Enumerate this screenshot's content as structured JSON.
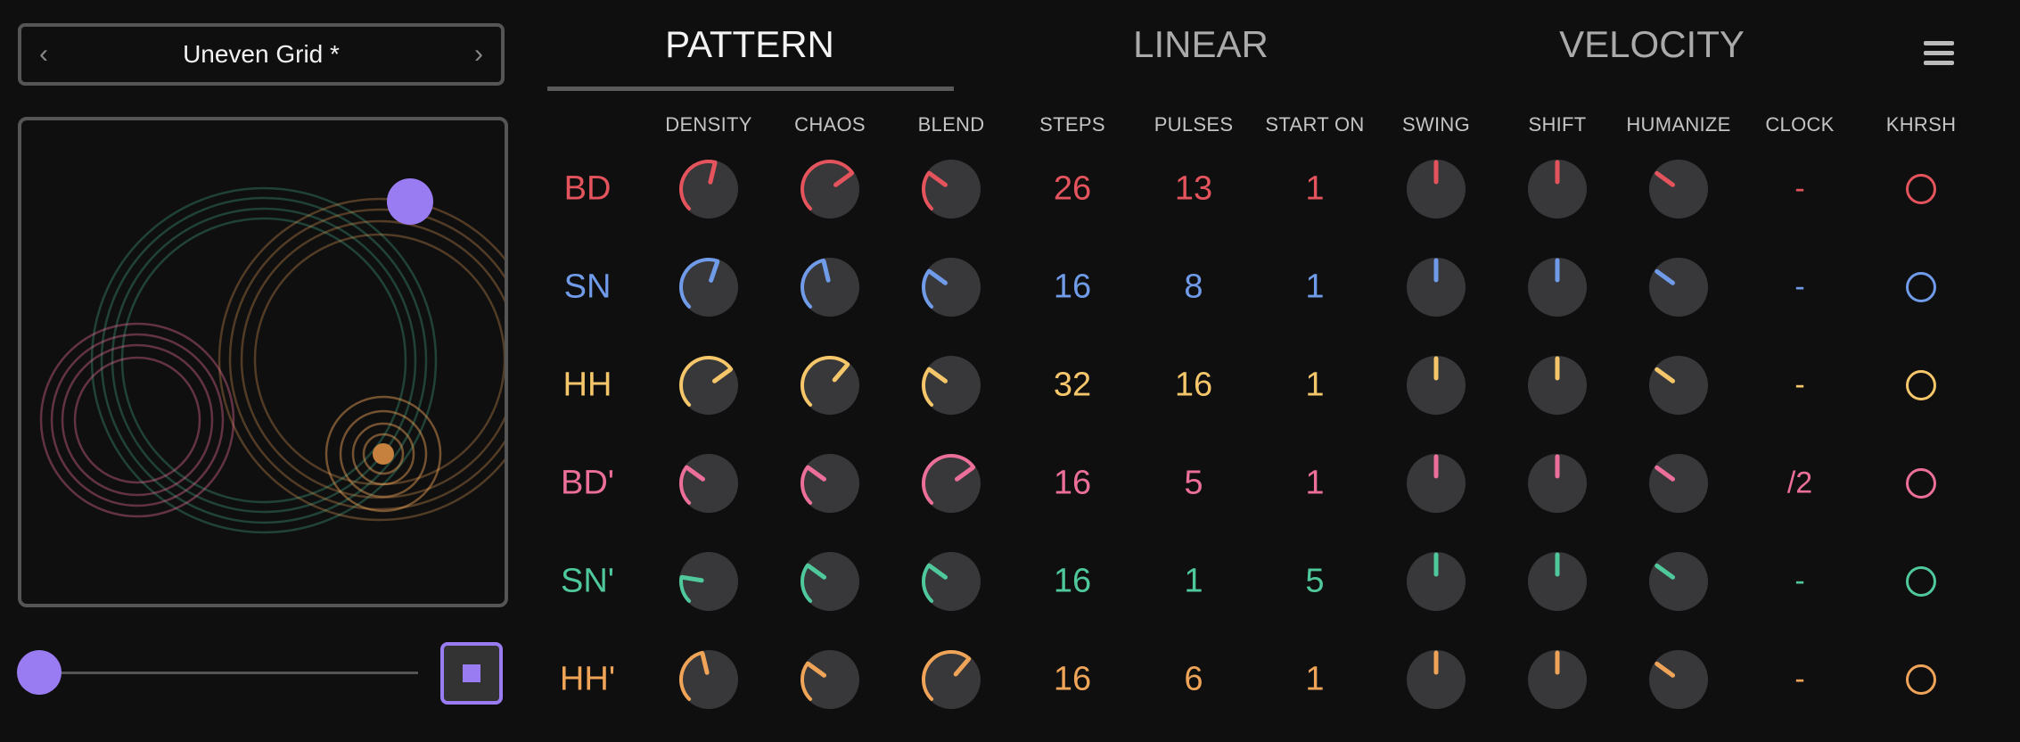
{
  "preset": {
    "name": "Uneven Grid *",
    "prev_icon": "chevron-left-icon",
    "next_icon": "chevron-right-icon",
    "prev_glyph": "‹",
    "next_glyph": "›"
  },
  "tabs": [
    {
      "label": "PATTERN",
      "active": true
    },
    {
      "label": "LINEAR",
      "active": false
    },
    {
      "label": "VELOCITY",
      "active": false
    }
  ],
  "menu_icon": "hamburger-menu-icon",
  "columns": [
    "DENSITY",
    "CHAOS",
    "BLEND",
    "STEPS",
    "PULSES",
    "START ON",
    "SWING",
    "SHIFT",
    "HUMANIZE",
    "CLOCK",
    "KHRSH"
  ],
  "colors": {
    "BD": "#e5545d",
    "SN": "#6f9be8",
    "HH": "#f5c76a",
    "BD'": "#ec6f9a",
    "SN'": "#4fc99c",
    "HH'": "#f0a458",
    "accent": "#9a7cf2",
    "knob_body": "#38383b"
  },
  "rows": [
    {
      "label": "BD",
      "color": "#e5545d",
      "density": 0.55,
      "chaos": 0.7,
      "blend": 0.3,
      "steps": "26",
      "pulses": "13",
      "start_on": "1",
      "swing": 0.5,
      "shift": 0.5,
      "humanize": 0.3,
      "clock": "-"
    },
    {
      "label": "SN",
      "color": "#6f9be8",
      "density": 0.57,
      "chaos": 0.45,
      "blend": 0.3,
      "steps": "16",
      "pulses": "8",
      "start_on": "1",
      "swing": 0.5,
      "shift": 0.5,
      "humanize": 0.3,
      "clock": "-"
    },
    {
      "label": "HH",
      "color": "#f5c76a",
      "density": 0.7,
      "chaos": 0.65,
      "blend": 0.3,
      "steps": "32",
      "pulses": "16",
      "start_on": "1",
      "swing": 0.5,
      "shift": 0.5,
      "humanize": 0.3,
      "clock": "-"
    },
    {
      "label": "BD'",
      "color": "#ec6f9a",
      "density": 0.3,
      "chaos": 0.3,
      "blend": 0.7,
      "steps": "16",
      "pulses": "5",
      "start_on": "1",
      "swing": 0.5,
      "shift": 0.5,
      "humanize": 0.3,
      "clock": "/2"
    },
    {
      "label": "SN'",
      "color": "#4fc99c",
      "density": 0.2,
      "chaos": 0.3,
      "blend": 0.3,
      "steps": "16",
      "pulses": "1",
      "start_on": "5",
      "swing": 0.5,
      "shift": 0.5,
      "humanize": 0.3,
      "clock": "-"
    },
    {
      "label": "HH'",
      "color": "#f0a458",
      "density": 0.45,
      "chaos": 0.3,
      "blend": 0.65,
      "steps": "16",
      "pulses": "6",
      "start_on": "1",
      "swing": 0.5,
      "shift": 0.5,
      "humanize": 0.3,
      "clock": "-"
    }
  ],
  "slider": {
    "value": 0.0
  },
  "transport": {
    "stop_icon": "stop-icon"
  }
}
